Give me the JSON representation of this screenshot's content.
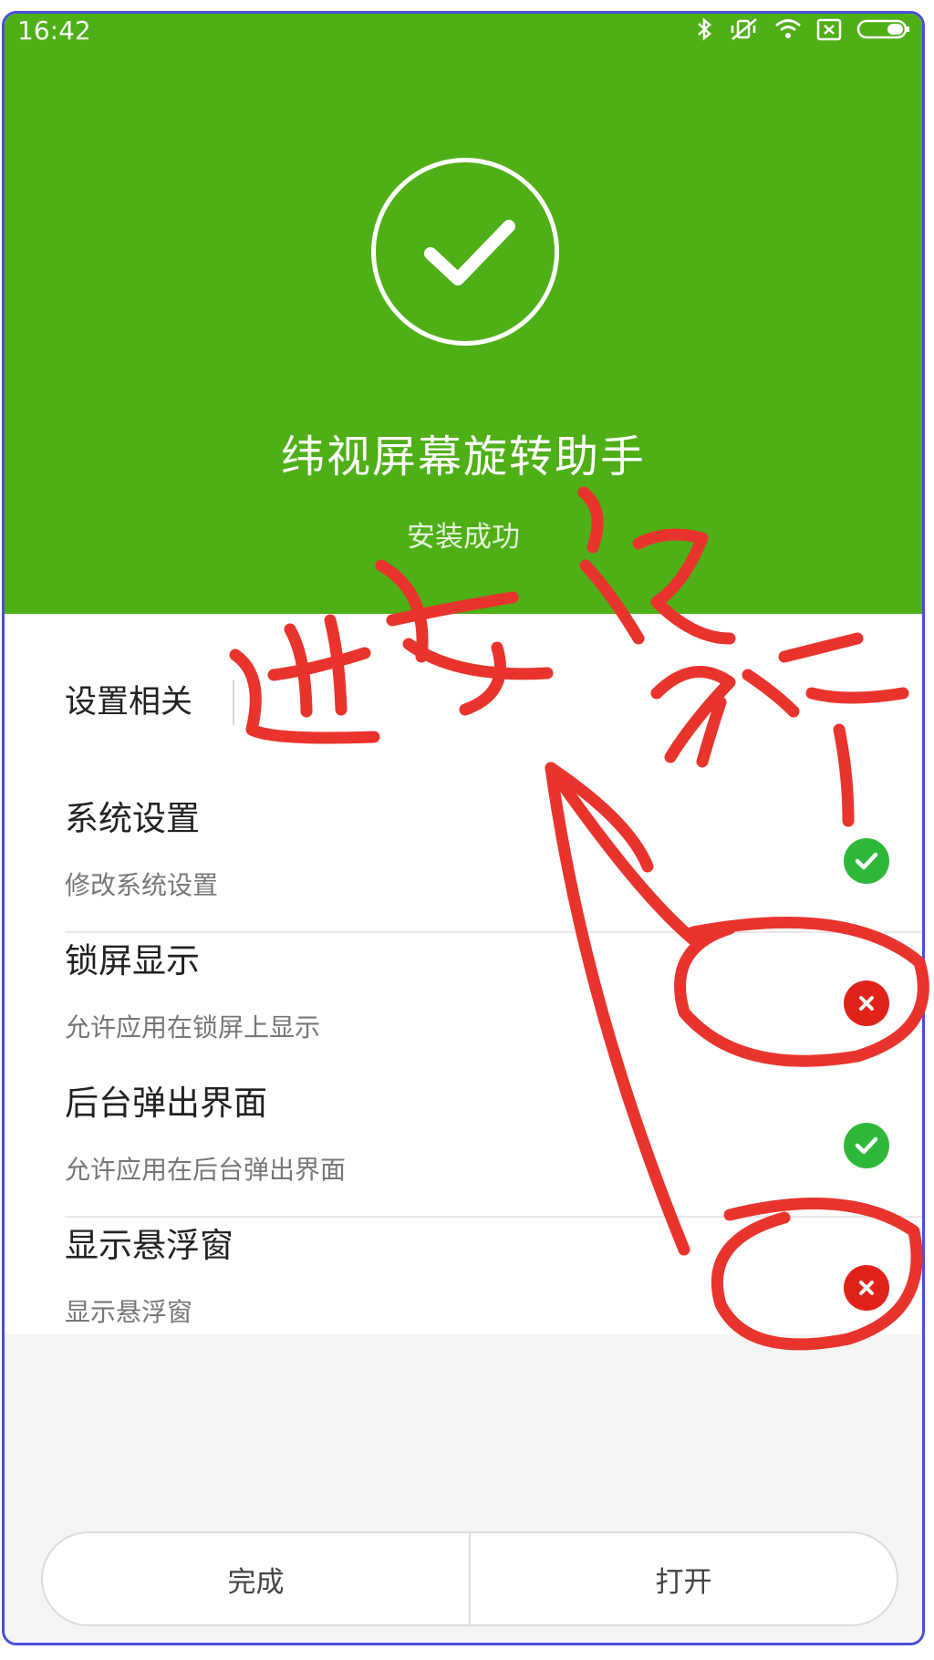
{
  "status_bar": {
    "time": "16:42",
    "icons": [
      "bluetooth-icon",
      "vibrate-off-icon",
      "wifi-icon",
      "sim-off-icon",
      "battery-icon"
    ]
  },
  "header": {
    "icon": "check-circle-icon",
    "app_name": "纬视屏幕旋转助手",
    "status": "安装成功",
    "bg_color": "#4faf16"
  },
  "settings": {
    "section_label": "设置相关",
    "items": [
      {
        "title": "系统设置",
        "subtitle": "修改系统设置",
        "status": "granted"
      },
      {
        "title": "锁屏显示",
        "subtitle": "允许应用在锁屏上显示",
        "status": "denied"
      },
      {
        "title": "后台弹出界面",
        "subtitle": "允许应用在后台弹出界面",
        "status": "granted"
      },
      {
        "title": "显示悬浮窗",
        "subtitle": "显示悬浮窗",
        "status": "denied"
      }
    ],
    "granted_color": "#2eb83a",
    "denied_color": "#e0231a"
  },
  "actions": {
    "done_label": "完成",
    "open_label": "打开"
  },
  "annotation": {
    "handwritten_text": "进去设允许",
    "ink_color": "#e8342c"
  }
}
